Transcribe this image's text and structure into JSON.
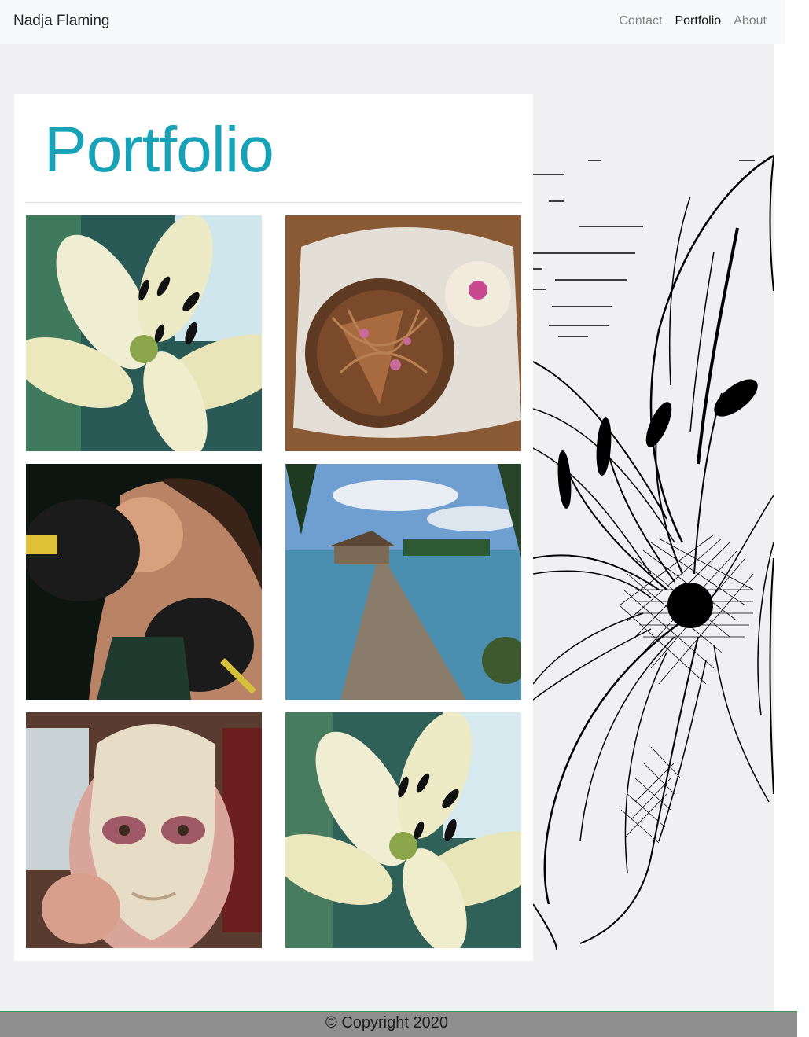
{
  "navbar": {
    "brand": "Nadja Flaming",
    "links": [
      {
        "label": "Contact",
        "active": false
      },
      {
        "label": "Portfolio",
        "active": true
      },
      {
        "label": "About",
        "active": false
      }
    ]
  },
  "main": {
    "title": "Portfolio",
    "gallery": [
      {
        "subject": "white-lily-flower"
      },
      {
        "subject": "chocolate-cake-and-cupcake"
      },
      {
        "subject": "woman-kissing-boxing-glove"
      },
      {
        "subject": "wooden-pier-over-sea"
      },
      {
        "subject": "woman-holding-mask"
      },
      {
        "subject": "white-lily-flower"
      }
    ]
  },
  "footer": {
    "copyright": "© Copyright 2020"
  },
  "colors": {
    "title": "#17a2b8",
    "navbar_bg": "#f8f9fa",
    "page_bg": "#f0f0f3",
    "footer_bg": "#8e8e8e"
  }
}
